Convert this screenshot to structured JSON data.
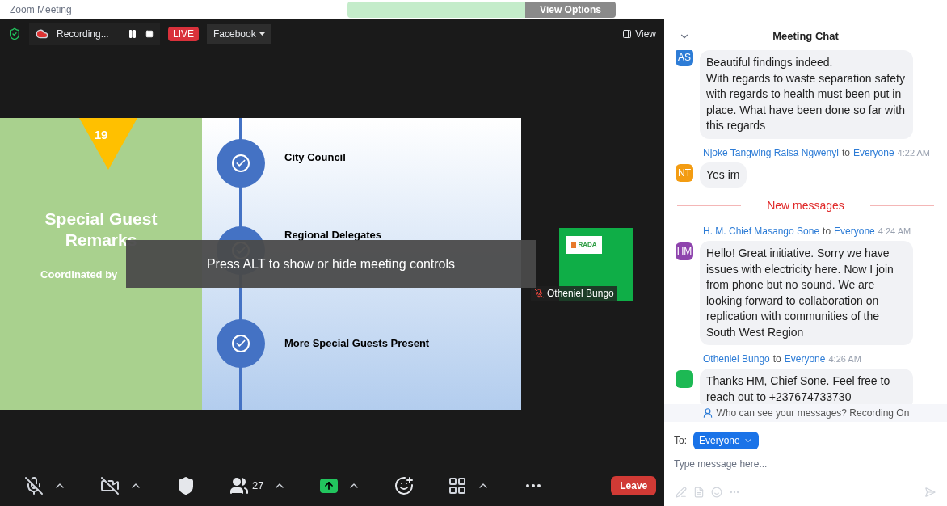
{
  "window": {
    "title": "Zoom Meeting"
  },
  "share_banner": {
    "button": "View Options"
  },
  "top_bar": {
    "secure": true,
    "recording": "Recording...",
    "live": "LIVE",
    "stream": "Facebook",
    "view": "View"
  },
  "slide": {
    "number": "19",
    "title": "Special Guest Remarks",
    "subtitle": "Coordinated by",
    "items": [
      "City Council",
      "Regional Delegates",
      "More Special Guests Present"
    ]
  },
  "overlay": "Press ALT to show or hide meeting controls",
  "participant_tile": {
    "name": "Otheniel Bungo",
    "muted": true,
    "logo": "RADA"
  },
  "toolbar": [
    {
      "kind": "mic",
      "off": true,
      "caret": true
    },
    {
      "kind": "video",
      "off": true,
      "caret": true
    },
    {
      "kind": "security",
      "caret": false
    },
    {
      "kind": "participants",
      "count": "27",
      "caret": true
    },
    {
      "kind": "share",
      "caret": true
    },
    {
      "kind": "reactions",
      "caret": false
    },
    {
      "kind": "apps",
      "caret": true
    },
    {
      "kind": "more",
      "caret": false
    }
  ],
  "leave": "Leave",
  "chat": {
    "title": "Meeting Chat",
    "messages": [
      {
        "kind": "message",
        "avatar": "AS",
        "color": "#2d7cd6",
        "text": "Beautiful findings indeed.\nWith regards to waste separation safety with regards to health must been put in place. What have been done so far with this regards"
      },
      {
        "kind": "message",
        "sender": "Njoke Tangwing Raisa Ngwenyi",
        "to": "to",
        "recipient": "Everyone",
        "time": "4:22 AM",
        "avatar": "NT",
        "color": "#f39c12",
        "text": "Yes im"
      },
      {
        "kind": "divider",
        "text": "New messages"
      },
      {
        "kind": "message",
        "sender": "H. M. Chief Masango Sone",
        "to": "to",
        "recipient": "Everyone",
        "time": "4:24 AM",
        "avatar": "HM",
        "color": "#8e44ad",
        "text": "Hello! Great initiative. Sorry we have issues with electricity here. Now I join from phone but no sound. We are looking forward to collaboration on replication with communities of the South West Region"
      },
      {
        "kind": "message",
        "sender": "Otheniel Bungo",
        "to": "to",
        "recipient": "Everyone",
        "time": "4:26 AM",
        "color": "#1db954",
        "text": "Thanks HM, Chief Sone. Feel free to reach out to +237674733730"
      }
    ],
    "notice": "Who can see your messages? Recording On",
    "to_label": "To:",
    "recipient": "Everyone",
    "placeholder": "Type message here..."
  }
}
